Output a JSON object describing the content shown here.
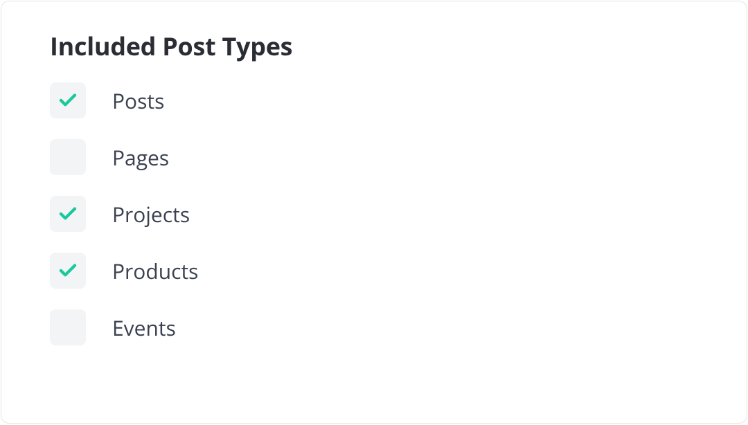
{
  "section": {
    "title": "Included Post Types",
    "items": [
      {
        "label": "Posts",
        "checked": true
      },
      {
        "label": "Pages",
        "checked": false
      },
      {
        "label": "Projects",
        "checked": true
      },
      {
        "label": "Products",
        "checked": true
      },
      {
        "label": "Events",
        "checked": false
      }
    ]
  },
  "colors": {
    "check": "#18c99d"
  }
}
